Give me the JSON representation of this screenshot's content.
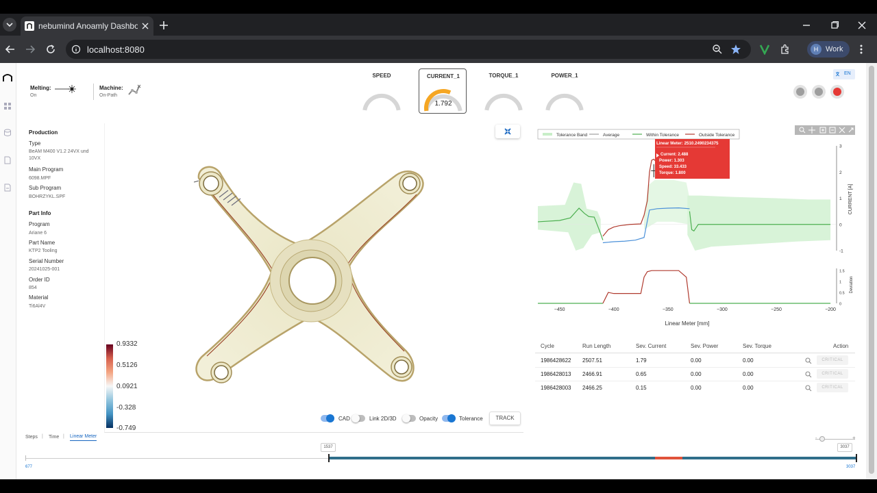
{
  "browser": {
    "tab_title": "nebumind Anoamly Dashboard",
    "url": "localhost:8080",
    "profile_initial": "H",
    "profile_label": "Work"
  },
  "status": {
    "melting_label": "Melting:",
    "melting_state": "On",
    "machine_label": "Machine:",
    "machine_state": "On-Path"
  },
  "gauges": [
    {
      "title": "SPEED",
      "value": ""
    },
    {
      "title": "CURRENT_1",
      "value": "1.792",
      "fill": 0.62
    },
    {
      "title": "TORQUE_1",
      "value": ""
    },
    {
      "title": "POWER_1",
      "value": ""
    }
  ],
  "lang_button": "EN",
  "sidebar": {
    "production_heading": "Production",
    "fields": [
      {
        "key": "Type",
        "value": "BeAM M400 V1.2 24VX und 10VX"
      },
      {
        "key": "Main Program",
        "value": "6098.MPF"
      },
      {
        "key": "Sub Program",
        "value": "BOHRZYKL.SPF"
      }
    ],
    "part_heading": "Part Info",
    "part_fields": [
      {
        "key": "Program",
        "value": "Ariane 6"
      },
      {
        "key": "Part Name",
        "value": "KTP2 Tooling"
      },
      {
        "key": "Serial Number",
        "value": "20241025-001"
      },
      {
        "key": "Order ID",
        "value": "854"
      },
      {
        "key": "Material",
        "value": "Ti6Al4V"
      }
    ]
  },
  "colorbar": {
    "ticks": [
      "0.9332",
      "0.5126",
      "0.0921",
      "-0.328",
      "-0.749"
    ]
  },
  "viewer_controls": {
    "cad": "CAD",
    "link": "Link 2D/3D",
    "opacity": "Opacity",
    "tolerance": "Tolerance",
    "track": "TRACK"
  },
  "axis_tabs": {
    "steps": "Steps",
    "time": "Time",
    "linear": "Linear Meter"
  },
  "slider": {
    "min": "677",
    "max": "3037",
    "current_left": "1537",
    "current_right": "3037"
  },
  "chart": {
    "legend": [
      "Tolerance Band",
      "Average",
      "Within Tolerance",
      "Outside Tolerance"
    ],
    "tooltip": {
      "title": "Linear Meter: 2510.2490234375",
      "lines": [
        "Current: 2.488",
        "Power: 1.303",
        "Speed: 33.433",
        "Torque: 1.800"
      ]
    },
    "y1_label": "CURRENT [A]",
    "y2_label": "Deviation",
    "x_label": "Linear Meter [mm]"
  },
  "chart_data": {
    "type": "line",
    "xlabel": "Linear Meter [mm]",
    "ylabel": "CURRENT [A]",
    "xlim": [
      -470,
      -195
    ],
    "ylim": [
      -1,
      3
    ],
    "x_ticks": [
      -450,
      -400,
      -350,
      -300,
      -250,
      -200
    ],
    "y_ticks": [
      -1,
      0,
      1,
      2,
      3
    ],
    "y2_ticks": [
      0,
      0.5,
      1,
      1.5
    ],
    "series": [
      {
        "name": "Within Tolerance",
        "color": "#4caf50",
        "x": [
          -470,
          -450,
          -440,
          -432,
          -427,
          -423,
          -418,
          -413,
          -410
        ],
        "y": [
          0.1,
          0.15,
          0.25,
          0.62,
          0.42,
          0.3,
          0.28,
          -0.25,
          -0.6
        ]
      },
      {
        "name": "Outside Tolerance",
        "color": "#b03a2e",
        "x": [
          -410,
          -405,
          -400,
          -395,
          -385,
          -375,
          -372,
          -369,
          -367,
          -365,
          -363,
          -361,
          -358
        ],
        "y": [
          -0.45,
          -0.2,
          -0.1,
          -0.05,
          0.0,
          0.02,
          0.35,
          0.9,
          2.0,
          2.45,
          2.49,
          2.4,
          2.3
        ]
      },
      {
        "name": "Average",
        "color": "#4a90d9",
        "x": [
          -410,
          -400,
          -390,
          -380,
          -372,
          -367,
          -360,
          -350,
          -340,
          -330
        ],
        "y": [
          -0.7,
          -0.66,
          -0.64,
          -0.6,
          -0.5,
          0.55,
          0.6,
          0.62,
          0.63,
          0.6
        ]
      },
      {
        "name": "Within Tolerance",
        "color": "#4caf50",
        "x": [
          -330,
          -328,
          -326,
          -322,
          -310,
          -290,
          -270,
          -250,
          -230,
          -210,
          -200
        ],
        "y": [
          0.5,
          -0.2,
          -0.25,
          0.0,
          0.0,
          0.0,
          0.0,
          0.0,
          0.0,
          0.0,
          0.0
        ]
      }
    ],
    "deviation": {
      "x": [
        -470,
        -410,
        -407,
        -405,
        -400,
        -375,
        -372,
        -369,
        -365,
        -340,
        -333,
        -330,
        -200
      ],
      "y": [
        0,
        0,
        0.3,
        0.5,
        0.45,
        0.45,
        1.2,
        1.45,
        1.5,
        1.5,
        1.2,
        0,
        0
      ]
    }
  },
  "table": {
    "headers": [
      "Cycle",
      "Run Length",
      "Sev. Current",
      "Sev. Power",
      "Sev. Torque",
      "Action"
    ],
    "rows": [
      {
        "cycle": "1986428622",
        "run": "2507.51",
        "cur": "1.79",
        "pow": "0.00",
        "tor": "0.00",
        "action": "CRITICAL"
      },
      {
        "cycle": "1986428013",
        "run": "2466.91",
        "cur": "0.65",
        "pow": "0.00",
        "tor": "0.00",
        "action": "CRITICAL"
      },
      {
        "cycle": "1986428003",
        "run": "2466.25",
        "cur": "0.15",
        "pow": "0.00",
        "tor": "0.00",
        "action": "CRITICAL"
      }
    ]
  },
  "colors": {
    "accent": "#1976d2",
    "gauge_fill": "#f5a623",
    "critical_red": "#e53935",
    "chrome_dark": "#202124"
  }
}
